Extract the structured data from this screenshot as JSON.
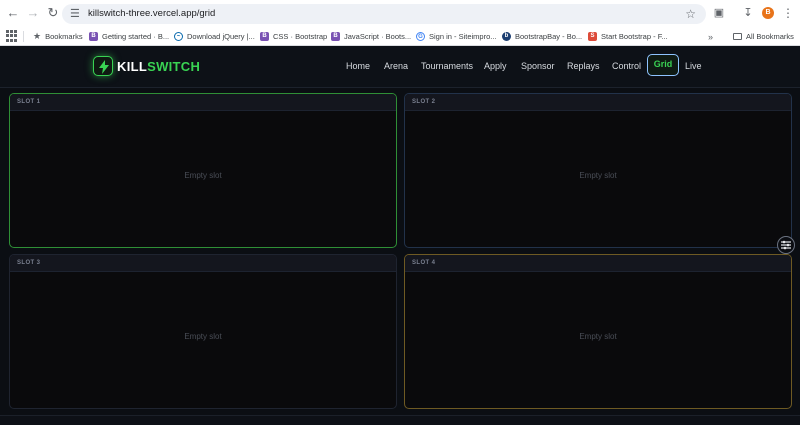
{
  "browser": {
    "url": "killswitch-three.vercel.app/grid",
    "profile_initial": "B",
    "bookmarks": [
      {
        "label": "Bookmarks",
        "color": "#5f6368"
      },
      {
        "label": "Getting started · B...",
        "color": "#7952b3"
      },
      {
        "label": "Download jQuery |...",
        "color": "#0769ad"
      },
      {
        "label": "CSS · Bootstrap",
        "color": "#7952b3"
      },
      {
        "label": "JavaScript · Boots...",
        "color": "#7952b3"
      },
      {
        "label": "Sign in - Siteimpro...",
        "color": "#4285f4"
      },
      {
        "label": "BootstrapBay - Bo...",
        "color": "#1d3f72"
      },
      {
        "label": "Start Bootstrap - F...",
        "color": "#dd4b39"
      }
    ],
    "all_bookmarks": "All Bookmarks"
  },
  "site": {
    "logo_kill": "KILL",
    "logo_switch": "SWITCH",
    "brand_color": "#39d353",
    "nav": [
      "Home",
      "Arena",
      "Tournaments",
      "Apply",
      "Sponsor",
      "Replays",
      "Control",
      "Grid",
      "Live"
    ],
    "active_nav": "Grid"
  },
  "grid": {
    "slots": [
      {
        "label": "SLOT 1",
        "status": "Empty slot",
        "border_color": "#2f8f36"
      },
      {
        "label": "SLOT 2",
        "status": "Empty slot",
        "border_color": "#22324a"
      },
      {
        "label": "SLOT 3",
        "status": "Empty slot",
        "border_color": "#1f2430"
      },
      {
        "label": "SLOT 4",
        "status": "Empty slot",
        "border_color": "#6e5a23"
      }
    ]
  }
}
